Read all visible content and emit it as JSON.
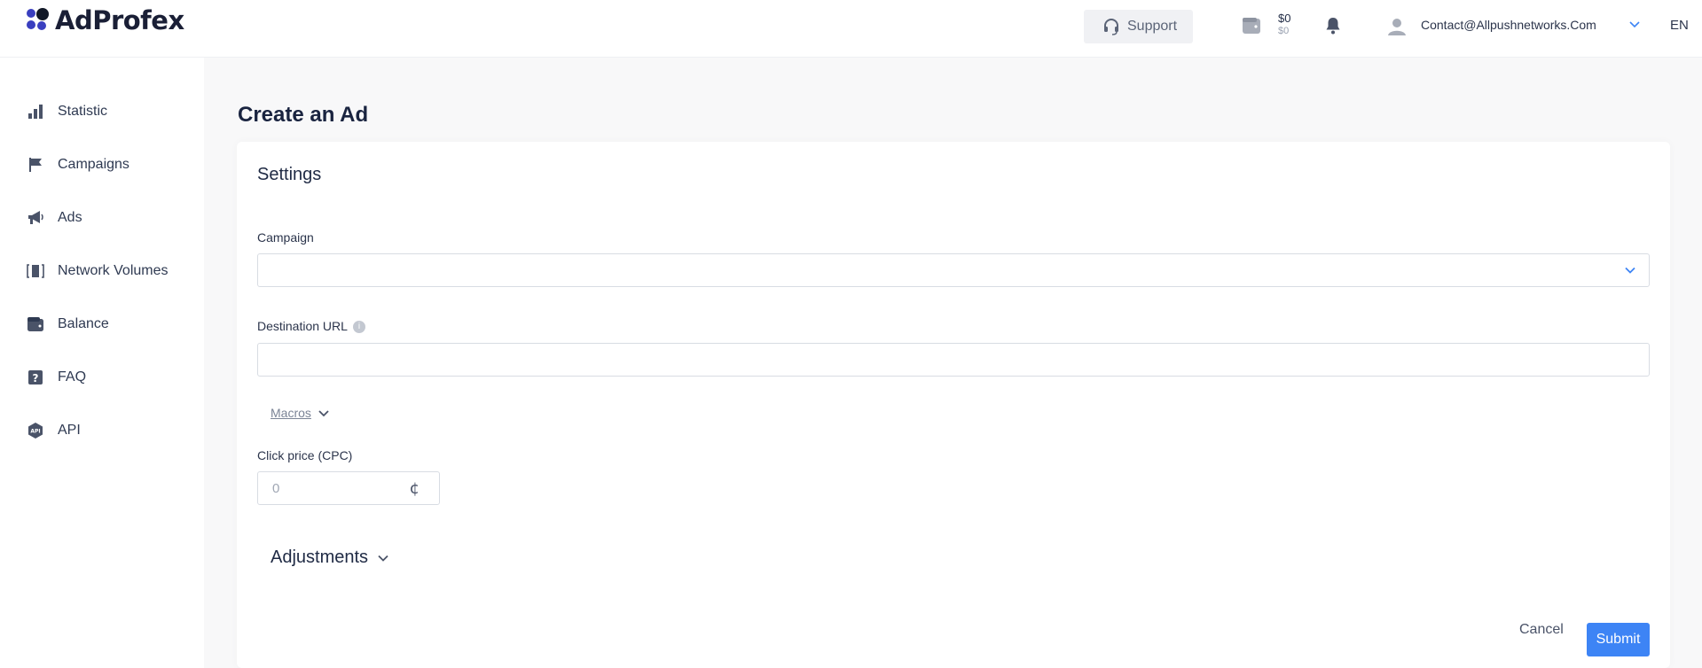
{
  "app": {
    "logo_text": "AdProfex"
  },
  "header": {
    "support_label": "Support",
    "balance_main": "$0",
    "balance_sub": "$0",
    "user_email": "Contact@Allpushnetworks.Com",
    "language": "EN"
  },
  "sidebar": {
    "items": [
      {
        "label": "Statistic",
        "icon": "bar-chart-icon"
      },
      {
        "label": "Campaigns",
        "icon": "flag-icon"
      },
      {
        "label": "Ads",
        "icon": "megaphone-icon"
      },
      {
        "label": "Network Volumes",
        "icon": "network-volumes-icon"
      },
      {
        "label": "Balance",
        "icon": "wallet-icon"
      },
      {
        "label": "FAQ",
        "icon": "question-icon"
      },
      {
        "label": "API",
        "icon": "api-icon"
      }
    ]
  },
  "main": {
    "page_title": "Create an Ad",
    "settings_title": "Settings",
    "campaign_label": "Campaign",
    "campaign_value": "",
    "destination_label": "Destination URL",
    "destination_value": "",
    "macros_label": "Macros",
    "cpc_label": "Click price (CPC)",
    "cpc_placeholder": "0",
    "cpc_unit": "¢",
    "adjustments_label": "Adjustments",
    "cancel_label": "Cancel",
    "submit_label": "Submit"
  },
  "colors": {
    "accent": "#3d84f5",
    "brand": "#3a3fbf",
    "text": "#1f2a44",
    "background": "#f8f8f9"
  }
}
